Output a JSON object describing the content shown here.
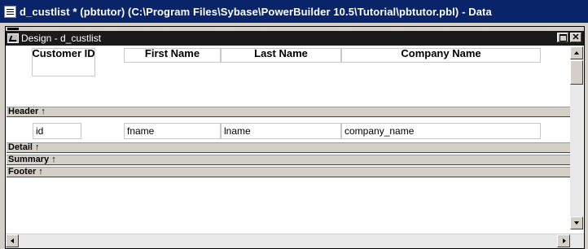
{
  "window": {
    "title": "d_custlist * (pbtutor) (C:\\Program Files\\Sybase\\PowerBuilder 10.5\\Tutorial\\pbtutor.pbl) - Data"
  },
  "child": {
    "title": "Design - d_custlist"
  },
  "columns": [
    {
      "label": "Customer ID",
      "field": "id"
    },
    {
      "label": "First Name",
      "field": "fname"
    },
    {
      "label": "Last Name",
      "field": "lname"
    },
    {
      "label": "Company Name",
      "field": "company_name"
    }
  ],
  "bands": {
    "header": "Header ↑",
    "detail": "Detail ↑",
    "summary": "Summary ↑",
    "footer": "Footer ↑"
  },
  "colors": {
    "title_active": "#0a246a",
    "child_title": "#1a1a1a",
    "band_bg": "#d4d0c8"
  }
}
